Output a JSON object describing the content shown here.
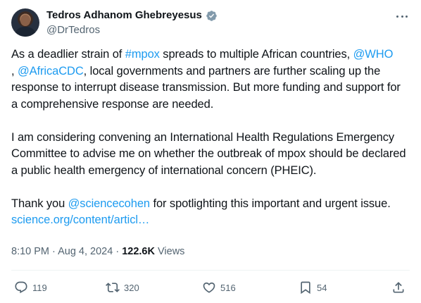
{
  "author": {
    "display_name": "Tedros Adhanom Ghebreyesus",
    "handle": "@DrTedros",
    "verified": true,
    "avatar_icon": "profile-photo"
  },
  "tweet": {
    "paragraph1": {
      "t1": "As a deadlier strain of ",
      "hashtag": "#mpox",
      "t2": " spreads to multiple African countries, ",
      "mention1": "@WHO",
      "t3": ", ",
      "mention2": "@AfricaCDC",
      "t4": ", local governments and partners are further scaling up the response to interrupt disease transmission. But more funding and support for a comprehensive response are needed."
    },
    "paragraph2": "I am considering convening an International Health Regulations Emergency Committee to advise me on whether the outbreak of mpox should be declared a public health emergency of international concern (PHEIC).",
    "paragraph3": {
      "t1": "Thank you ",
      "mention": "@sciencecohen",
      "t2": " for spotlighting this important and urgent issue.",
      "link": "science.org/content/articl…"
    }
  },
  "meta": {
    "time": "8:10 PM",
    "separator": " · ",
    "date": "Aug 4, 2024",
    "views_count": "122.6K",
    "views_label": " Views"
  },
  "actions": {
    "replies": "119",
    "reposts": "320",
    "likes": "516",
    "bookmarks": "54"
  },
  "colors": {
    "link": "#1d9bf0",
    "secondary_text": "#536471",
    "primary_text": "#0f1419",
    "divider": "#eff3f4"
  }
}
